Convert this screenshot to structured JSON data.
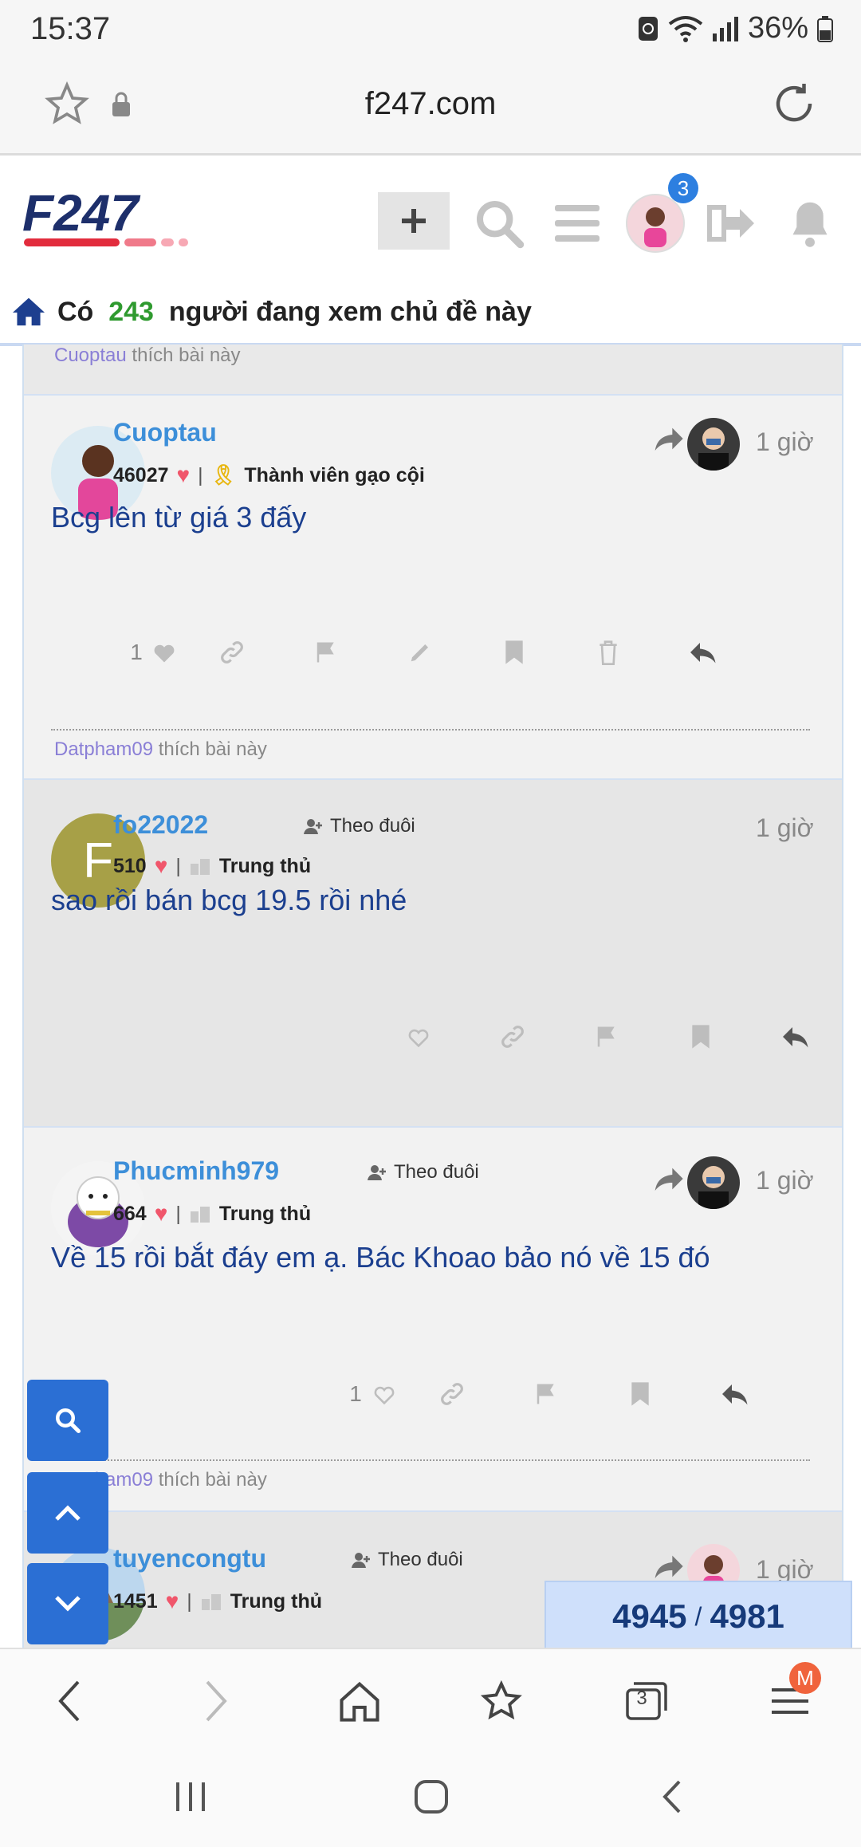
{
  "status_bar": {
    "time": "15:37",
    "battery": "36%"
  },
  "browser": {
    "url": "f247.com",
    "tabs_count": "3",
    "menu_badge": "M"
  },
  "site": {
    "logo_text": "F247",
    "notif_count": "3",
    "viewers": {
      "prefix": "Có",
      "count": "243",
      "suffix": "người đang xem chủ đề này"
    }
  },
  "posts": [
    {
      "likes_user": "Cuoptau",
      "likes_text": "thích bài này"
    },
    {
      "username": "Cuoptau",
      "points": "46027",
      "rank": "Thành viên gạo cội",
      "time": "1 giờ",
      "body": "Bcg lên từ giá 3 đấy",
      "like_count": "1",
      "likes_user": "Datpham09",
      "likes_text": "thích bài này"
    },
    {
      "username": "fo22022",
      "avatar_letter": "F",
      "follow": "Theo đuôi",
      "points": "510",
      "rank": "Trung thủ",
      "time": "1 giờ",
      "body": "sao rồi bán bcg 19.5 rồi nhé"
    },
    {
      "username": "Phucminh979",
      "follow": "Theo đuôi",
      "points": "664",
      "rank": "Trung thủ",
      "time": "1 giờ",
      "body": "Về 15 rồi bắt đáy em ạ. Bác Khoao bảo nó về 15 đó",
      "like_count": "1",
      "likes_user": "Datpham09",
      "likes_text": "thích bài này"
    },
    {
      "username": "tuyencongtu",
      "follow": "Theo đuôi",
      "points": "1451",
      "rank": "Trung thủ",
      "time": "1 giờ"
    }
  ],
  "pager": {
    "current": "4945",
    "separator": "/",
    "total": "4981"
  },
  "colors": {
    "accent": "#3d8fd9",
    "fab": "#2b6fd4",
    "heart": "#f0566b",
    "body_text": "#1b3f8f"
  }
}
